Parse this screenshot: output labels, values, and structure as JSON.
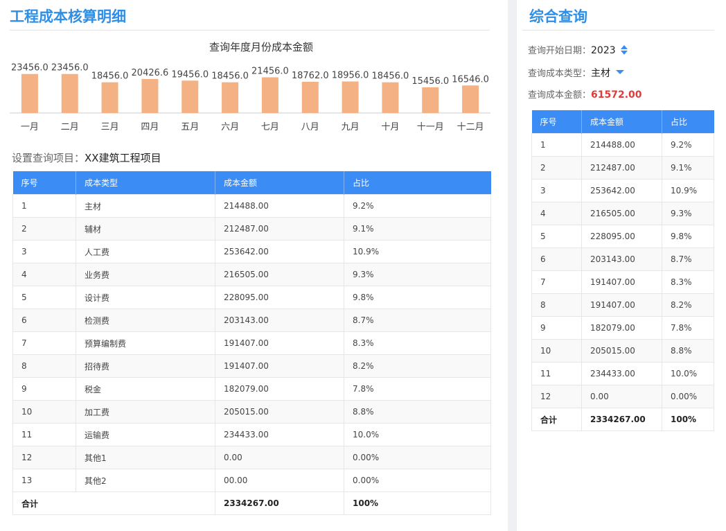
{
  "left_panel": {
    "title": "工程成本核算明细",
    "project_label": "设置查询项目：",
    "project_value": "XX建筑工程项目"
  },
  "chart_data": {
    "type": "bar",
    "title": "查询年度月份成本金额",
    "categories": [
      "一月",
      "二月",
      "三月",
      "四月",
      "五月",
      "六月",
      "七月",
      "八月",
      "九月",
      "十月",
      "十一月",
      "十二月"
    ],
    "values": [
      23456.0,
      23456.0,
      18456.0,
      20426.6,
      19456.0,
      18456.0,
      21456.0,
      18762.0,
      18956.0,
      18456.0,
      15456.0,
      16546.0
    ],
    "labels": [
      "23456.0",
      "23456.0",
      "18456.0",
      "20426.6",
      "19456.0",
      "18456.0",
      "21456.0",
      "18762.0",
      "18956.0",
      "18456.0",
      "15456.0",
      "16546.0"
    ],
    "ylim": [
      0,
      25000
    ],
    "bar_color": "#f4b183",
    "grid": false
  },
  "main_table": {
    "headers": [
      "序号",
      "成本类型",
      "成本金额",
      "占比"
    ],
    "rows": [
      [
        "1",
        "主材",
        "214488.00",
        "9.2%"
      ],
      [
        "2",
        "辅材",
        "212487.00",
        "9.1%"
      ],
      [
        "3",
        "人工费",
        "253642.00",
        "10.9%"
      ],
      [
        "4",
        "业务费",
        "216505.00",
        "9.3%"
      ],
      [
        "5",
        "设计费",
        "228095.00",
        "9.8%"
      ],
      [
        "6",
        "检测费",
        "203143.00",
        "8.7%"
      ],
      [
        "7",
        "预算编制费",
        "191407.00",
        "8.3%"
      ],
      [
        "8",
        "招待费",
        "191407.00",
        "8.2%"
      ],
      [
        "9",
        "税金",
        "182079.00",
        "7.8%"
      ],
      [
        "10",
        "加工费",
        "205015.00",
        "8.8%"
      ],
      [
        "11",
        "运输费",
        "234433.00",
        "10.0%"
      ],
      [
        "12",
        "其他1",
        "0.00",
        "0.00%"
      ],
      [
        "13",
        "其他2",
        "00.00",
        "0.00%"
      ]
    ],
    "total": {
      "label": "合计",
      "amount": "2334267.00",
      "ratio": "100%"
    }
  },
  "right_panel": {
    "title": "综合查询",
    "start_date_label": "查询开始日期：",
    "start_date_value": "2023",
    "cost_type_label": "查询成本类型：",
    "cost_type_value": "主材",
    "amount_label": "查询成本金额：",
    "amount_value": "61572.00"
  },
  "side_table": {
    "headers": [
      "序号",
      "成本金额",
      "占比"
    ],
    "rows": [
      [
        "1",
        "214488.00",
        "9.2%"
      ],
      [
        "2",
        "212487.00",
        "9.1%"
      ],
      [
        "3",
        "253642.00",
        "10.9%"
      ],
      [
        "4",
        "216505.00",
        "9.3%"
      ],
      [
        "5",
        "228095.00",
        "9.8%"
      ],
      [
        "6",
        "203143.00",
        "8.7%"
      ],
      [
        "7",
        "191407.00",
        "8.3%"
      ],
      [
        "8",
        "191407.00",
        "8.2%"
      ],
      [
        "9",
        "182079.00",
        "7.8%"
      ],
      [
        "10",
        "205015.00",
        "8.8%"
      ],
      [
        "11",
        "234433.00",
        "10.0%"
      ],
      [
        "12",
        "0.00",
        "0.00%"
      ]
    ],
    "total": {
      "label": "合计",
      "amount": "2334267.00",
      "ratio": "100%"
    }
  },
  "colors": {
    "accent": "#2f8fe6",
    "header_bg": "#3b8cf5",
    "highlight": "#e03a3a"
  }
}
